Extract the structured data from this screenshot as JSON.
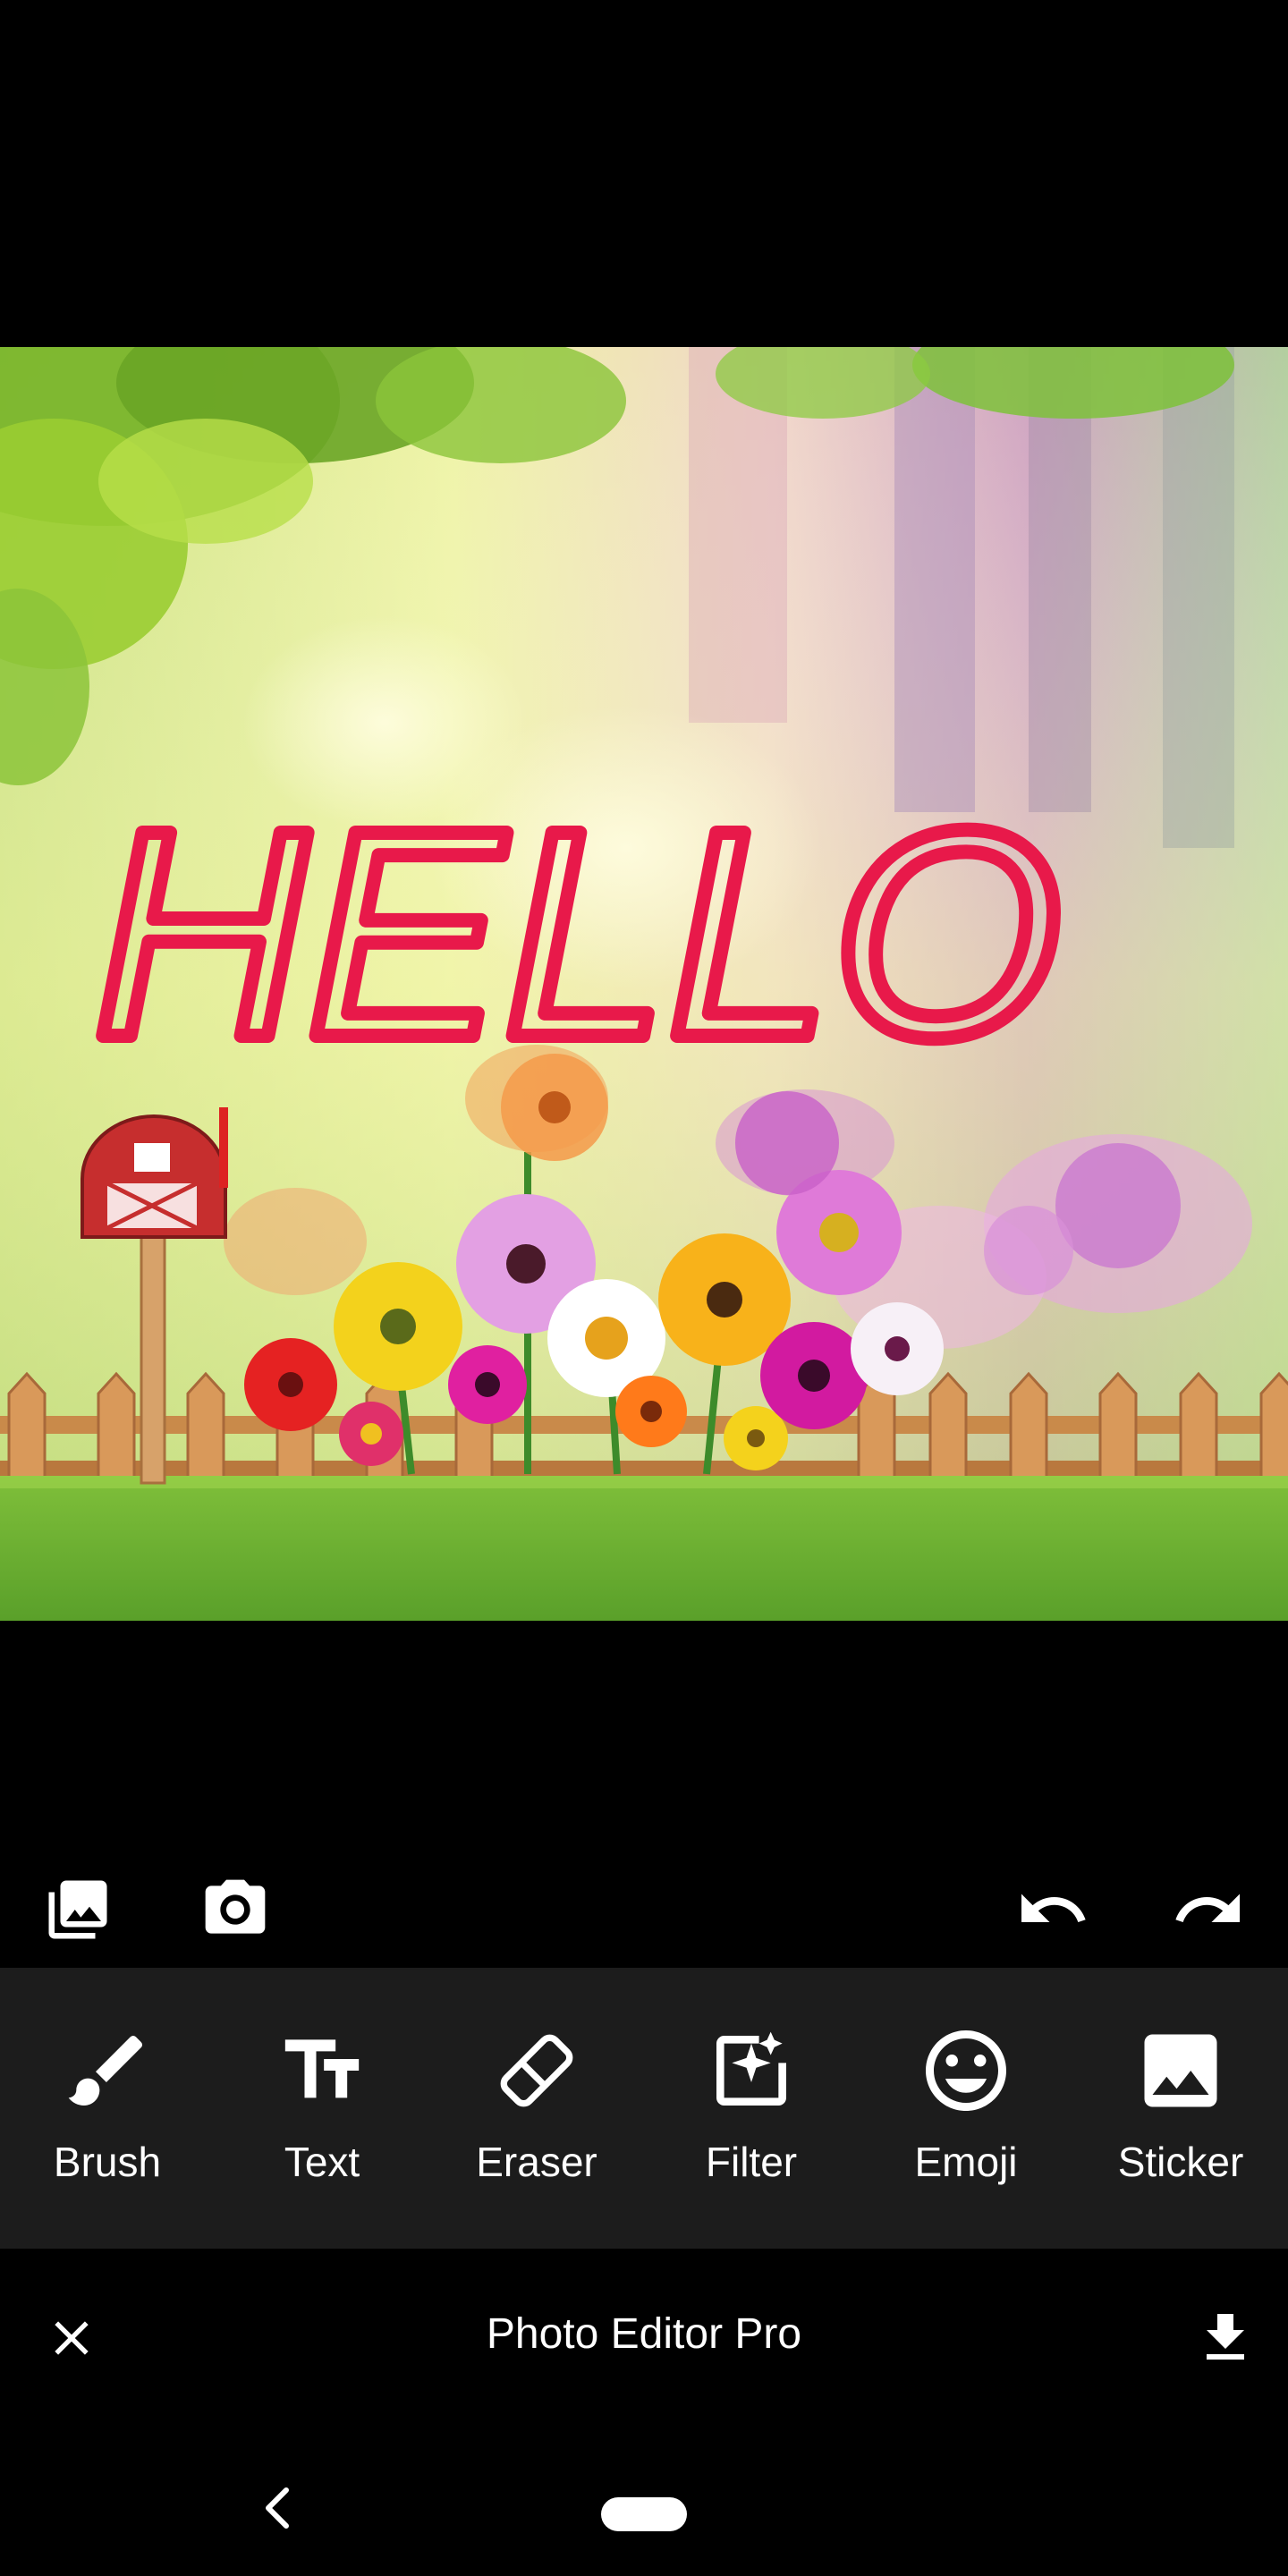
{
  "canvas": {
    "drawn_text": "HELLO",
    "drawn_text_color": "#e8194a"
  },
  "mini_toolbar": {
    "icons": [
      "gallery-icon",
      "camera-icon",
      "undo-icon",
      "redo-icon"
    ]
  },
  "tools": [
    {
      "label": "Brush",
      "icon": "brush-icon"
    },
    {
      "label": "Text",
      "icon": "text-icon"
    },
    {
      "label": "Eraser",
      "icon": "eraser-icon"
    },
    {
      "label": "Filter",
      "icon": "filter-icon"
    },
    {
      "label": "Emoji",
      "icon": "emoji-icon"
    },
    {
      "label": "Sticker",
      "icon": "sticker-icon"
    }
  ],
  "app_bar": {
    "title": "Photo Editor Pro",
    "close_icon": "close-icon",
    "download_icon": "download-icon"
  },
  "colors": {
    "background": "#000000",
    "toolbar_bg": "#1c1c1c",
    "accent_text": "#e8194a"
  }
}
